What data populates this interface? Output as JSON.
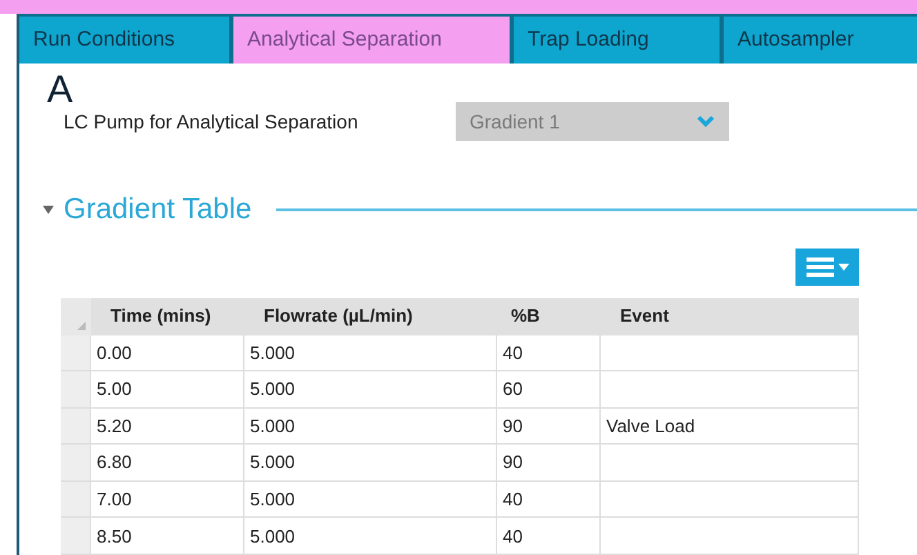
{
  "tabs": [
    {
      "label": "Run Conditions",
      "selected": false
    },
    {
      "label": "Analytical Separation",
      "selected": true
    },
    {
      "label": "Trap Loading",
      "selected": false
    },
    {
      "label": "Autosampler",
      "selected": false
    }
  ],
  "section_letter": "A",
  "pump": {
    "label": "LC Pump for Analytical Separation",
    "value": "Gradient 1",
    "disabled": true
  },
  "gradient_table": {
    "title": "Gradient Table",
    "expanded": true,
    "columns": [
      "Time (mins)",
      "Flowrate (µL/min)",
      "%B",
      "Event"
    ],
    "rows": [
      [
        "0.00",
        "5.000",
        "40",
        ""
      ],
      [
        "5.00",
        "5.000",
        "60",
        ""
      ],
      [
        "5.20",
        "5.000",
        "90",
        "Valve Load"
      ],
      [
        "6.80",
        "5.000",
        "90",
        ""
      ],
      [
        "7.00",
        "5.000",
        "40",
        ""
      ],
      [
        "8.50",
        "5.000",
        "40",
        ""
      ]
    ]
  }
}
